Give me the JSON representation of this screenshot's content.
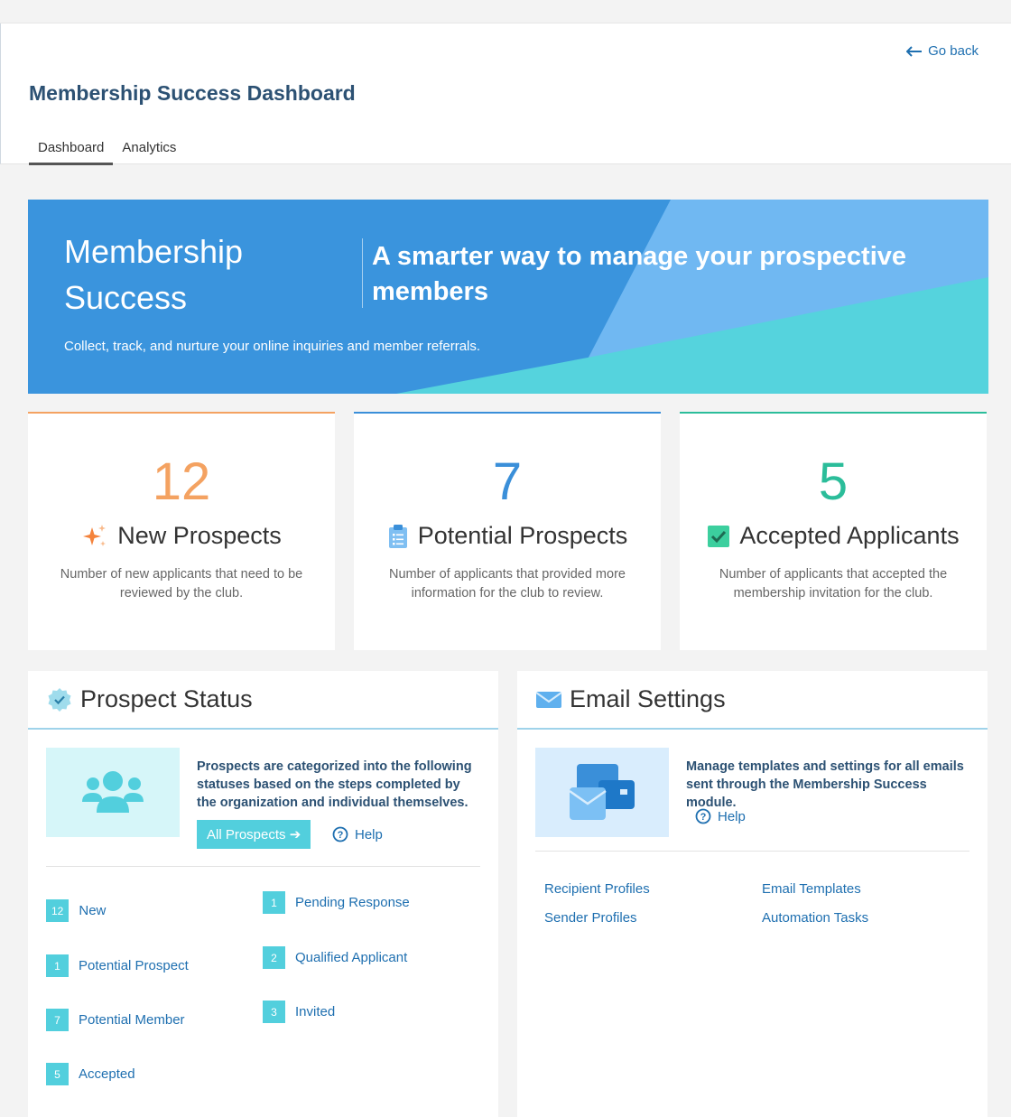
{
  "header": {
    "go_back": "Go back",
    "title": "Membership Success Dashboard",
    "tabs": [
      "Dashboard",
      "Analytics"
    ]
  },
  "banner": {
    "title_line1": "Membership",
    "title_line2": "Success",
    "tagline": "A smarter way to manage your prospective members",
    "subtitle": "Collect, track, and nurture your online inquiries and member referrals."
  },
  "stats": [
    {
      "value": "12",
      "label": "New Prospects",
      "desc": "Number of new applicants that need to be reviewed by the club.",
      "color": "#f4a261",
      "icon": "sparkle-icon"
    },
    {
      "value": "7",
      "label": "Potential Prospects",
      "desc": "Number of applicants that provided more information for the club to review.",
      "color": "#3a8fd9",
      "icon": "clipboard-icon"
    },
    {
      "value": "5",
      "label": "Accepted Applicants",
      "desc": "Number of applicants that accepted the membership invitation for the club.",
      "color": "#2bbd9a",
      "icon": "check-box-icon"
    }
  ],
  "prospect_status": {
    "title": "Prospect Status",
    "description": "Prospects are categorized into the following statuses based on the steps completed by the organization and individual themselves.",
    "button": "All Prospects",
    "help": "Help",
    "statuses": [
      {
        "count": "12",
        "label": "New"
      },
      {
        "count": "1",
        "label": "Pending Response"
      },
      {
        "count": "1",
        "label": "Potential Prospect"
      },
      {
        "count": "2",
        "label": "Qualified Applicant"
      },
      {
        "count": "7",
        "label": "Potential Member"
      },
      {
        "count": "3",
        "label": "Invited"
      },
      {
        "count": "5",
        "label": "Accepted"
      }
    ]
  },
  "email_settings": {
    "title": "Email Settings",
    "description": "Manage templates and settings for all emails sent through the Membership Success module.",
    "help": "Help",
    "links": [
      "Recipient Profiles",
      "Email Templates",
      "Sender Profiles",
      "Automation Tasks"
    ]
  },
  "colors": {
    "accent": "#52cfdd",
    "link": "#1e6fb0",
    "title": "#2c5173",
    "banner": "#3a94dd"
  }
}
